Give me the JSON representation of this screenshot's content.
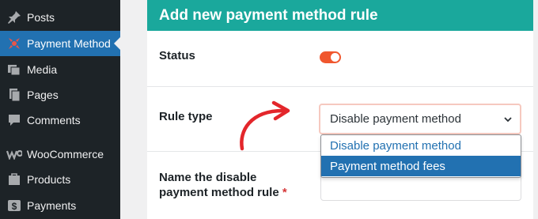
{
  "sidebar": {
    "items": [
      {
        "label": "Posts",
        "icon": "pin-icon",
        "active": false
      },
      {
        "label": "Payment Method",
        "icon": "payment-method-icon",
        "active": true
      },
      {
        "label": "Media",
        "icon": "media-icon",
        "active": false
      },
      {
        "label": "Pages",
        "icon": "pages-icon",
        "active": false
      },
      {
        "label": "Comments",
        "icon": "comments-icon",
        "active": false
      },
      {
        "label": "WooCommerce",
        "icon": "woocommerce-icon",
        "active": false
      },
      {
        "label": "Products",
        "icon": "products-icon",
        "active": false
      },
      {
        "label": "Payments",
        "icon": "payments-icon",
        "active": false
      }
    ]
  },
  "panel": {
    "title": "Add new payment method rule",
    "status_label": "Status",
    "status_on": true,
    "rule_type_label": "Rule type",
    "rule_type_value": "Disable payment method",
    "rule_type_options": [
      "Disable payment method",
      "Payment method fees"
    ],
    "rule_name_label_line1": "Name the disable",
    "rule_name_label_line2": "payment method rule",
    "required_mark": "*"
  },
  "colors": {
    "header": "#1aa89c",
    "sidebar_bg": "#1d2327",
    "active_item": "#2271b1",
    "toggle_on": "#f0572e",
    "arrow": "#e3262b"
  }
}
